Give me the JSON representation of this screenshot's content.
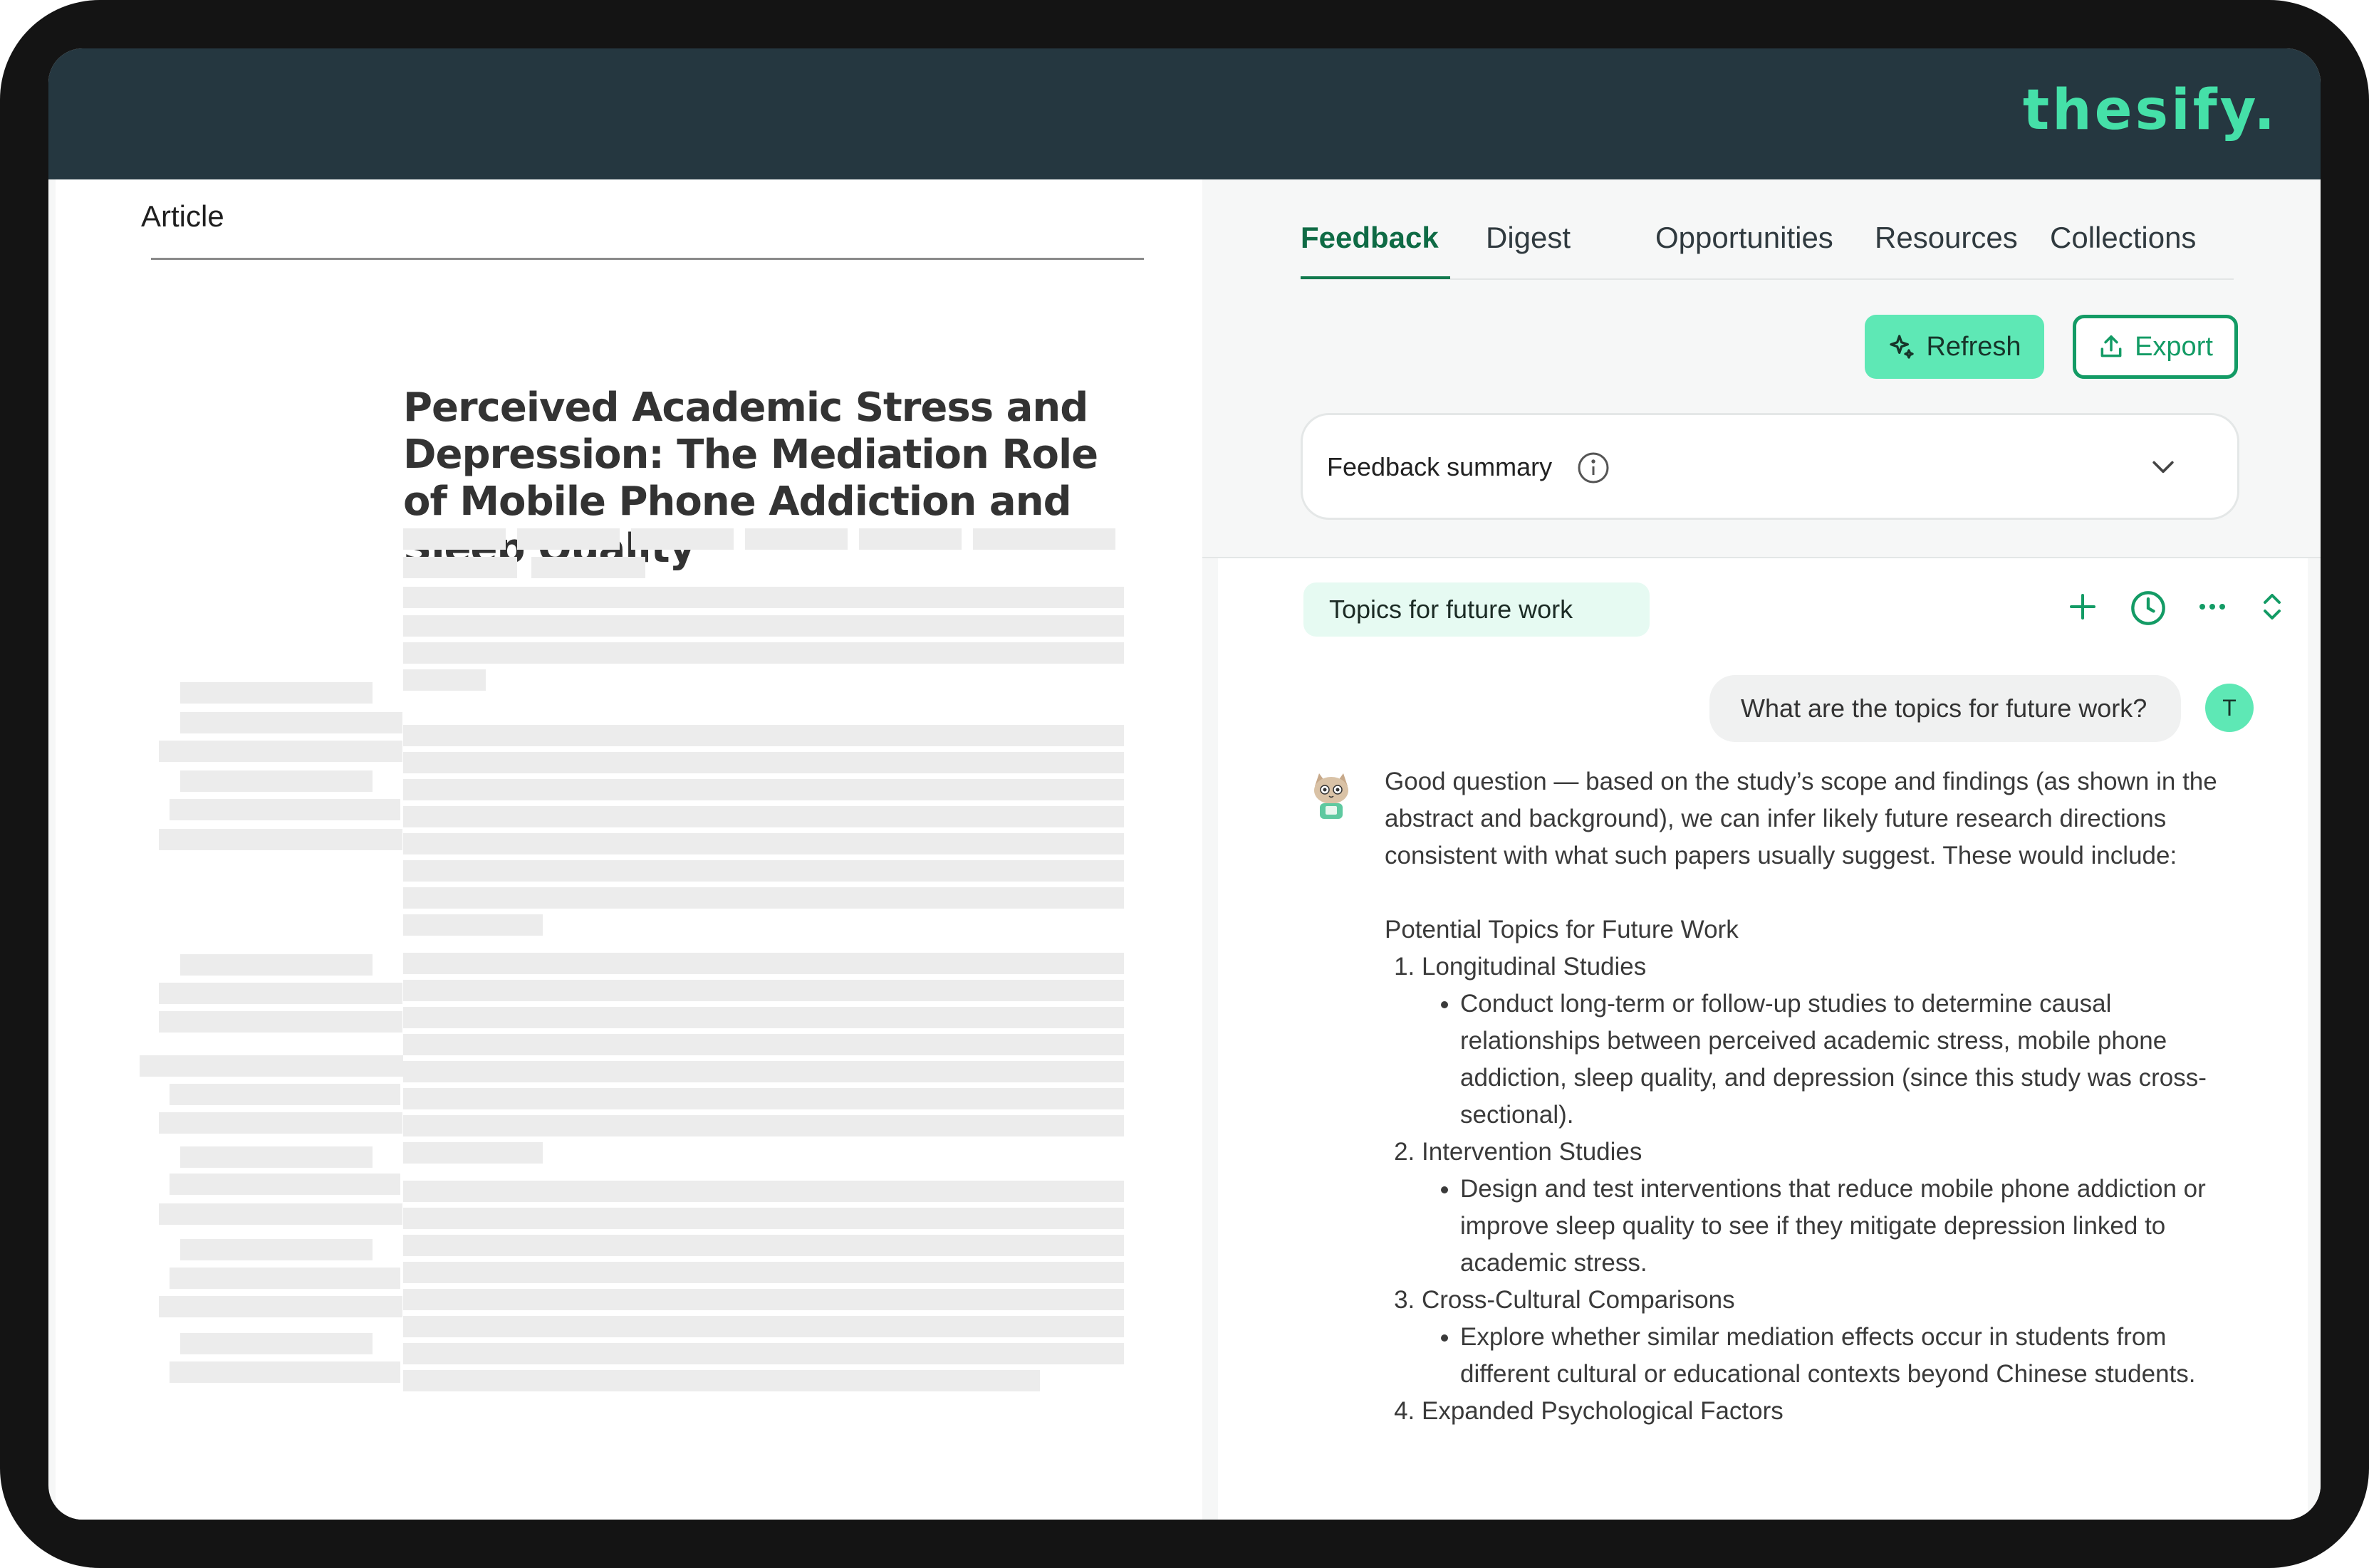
{
  "app": {
    "logo": "thesify."
  },
  "document": {
    "tab_label": "Article",
    "title": "Perceived Academic Stress and Depression: The Mediation Role of Mobile Phone Addiction and Sleep Quality"
  },
  "panel": {
    "tabs": [
      {
        "label": "Feedback",
        "active": true
      },
      {
        "label": "Digest",
        "active": false
      },
      {
        "label": "Opportunities",
        "active": false
      },
      {
        "label": "Resources",
        "active": false
      },
      {
        "label": "Collections",
        "active": false
      }
    ],
    "refresh_label": "Refresh",
    "export_label": "Export",
    "summary_label": "Feedback summary"
  },
  "chat": {
    "topic": "Topics for future work",
    "user_question": "What are the topics for future work?",
    "user_initial": "T",
    "answer_intro": "Good question — based on the study’s scope and findings (as shown in the abstract and background), we can infer likely future research directions consistent with what such papers usually suggest. These would include:",
    "list_heading": "Potential Topics for Future Work",
    "items": [
      {
        "title": "Longitudinal Studies",
        "bullet": "Conduct long-term or follow-up studies to determine causal relationships between perceived academic stress, mobile phone addiction, sleep quality, and depression (since this study was cross-sectional)."
      },
      {
        "title": "Intervention Studies",
        "bullet": "Design and test interventions that reduce mobile phone addiction or improve sleep quality to see if they mitigate depression linked to academic stress."
      },
      {
        "title": "Cross-Cultural Comparisons",
        "bullet": "Explore whether similar mediation effects occur in students from different cultural or educational contexts beyond Chinese students."
      },
      {
        "title": "Expanded Psychological Factors",
        "bullet": ""
      }
    ]
  },
  "colors": {
    "topbar": "#253740",
    "brand_green": "#45e0a8",
    "accent_button": "#5ee8b5",
    "active_tab": "#0f6b45",
    "export_border": "#139b65"
  },
  "icons": [
    "sparkle-icon",
    "upload-icon",
    "info-icon",
    "chevron-down-icon",
    "plus-icon",
    "clock-icon",
    "more-icon",
    "expand-collapse-icon",
    "cat-bot-avatar-icon"
  ]
}
